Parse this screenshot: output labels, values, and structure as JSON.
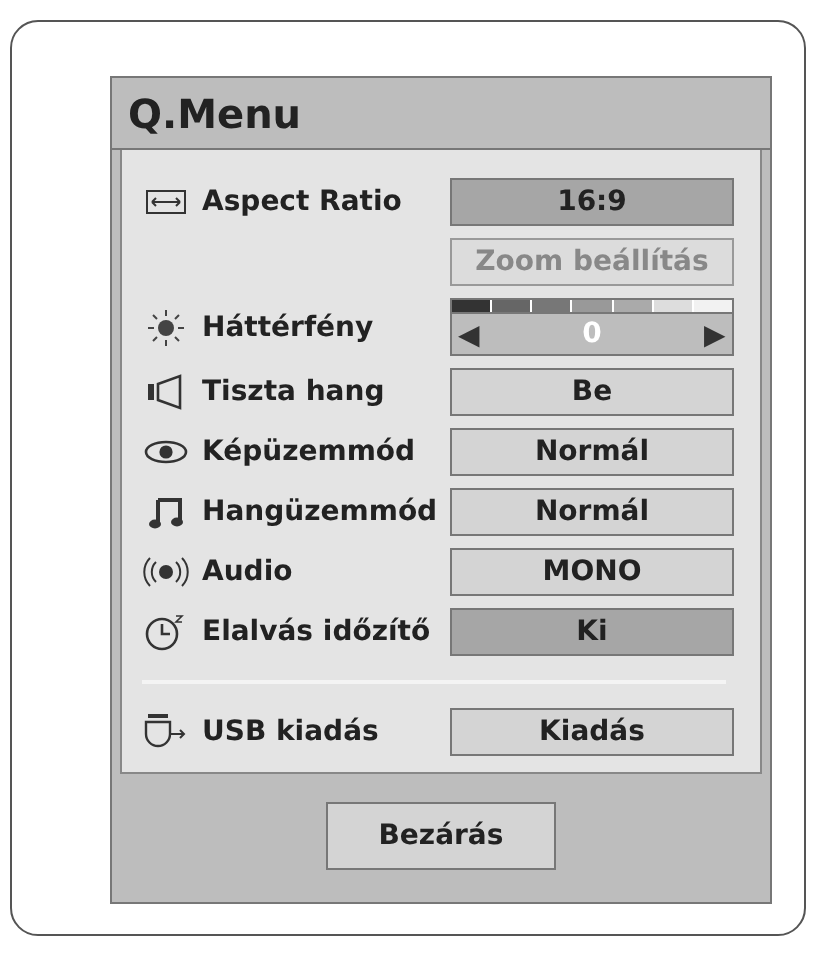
{
  "title": "Q.Menu",
  "groups": [
    [
      {
        "kind": "option",
        "label": "Aspect Ratio",
        "value": "16:9",
        "selected": true
      },
      {
        "kind": "option",
        "value": "Zoom beállítás",
        "selected": false,
        "disabled": true
      },
      {
        "kind": "slider",
        "label": "Háttérfény",
        "value": "0",
        "left": "◀",
        "right": "▶",
        "selected": false
      },
      {
        "kind": "option",
        "label": "Tiszta hang",
        "value": "Be",
        "selected": false
      },
      {
        "kind": "option",
        "label": "Képüzemmód",
        "value": "Normál",
        "selected": false
      },
      {
        "kind": "option",
        "label": "Hangüzemmód",
        "value": "Normál",
        "selected": false
      },
      {
        "kind": "option",
        "label": "Audio",
        "value": "MONO",
        "selected": false
      },
      {
        "kind": "option",
        "label": "Elalvás időzítő",
        "value": "Ki",
        "selected": true
      }
    ],
    [
      {
        "kind": "option",
        "label": "USB kiadás",
        "value": "Kiadás",
        "selected": false
      }
    ]
  ],
  "close_button": "Bezárás"
}
